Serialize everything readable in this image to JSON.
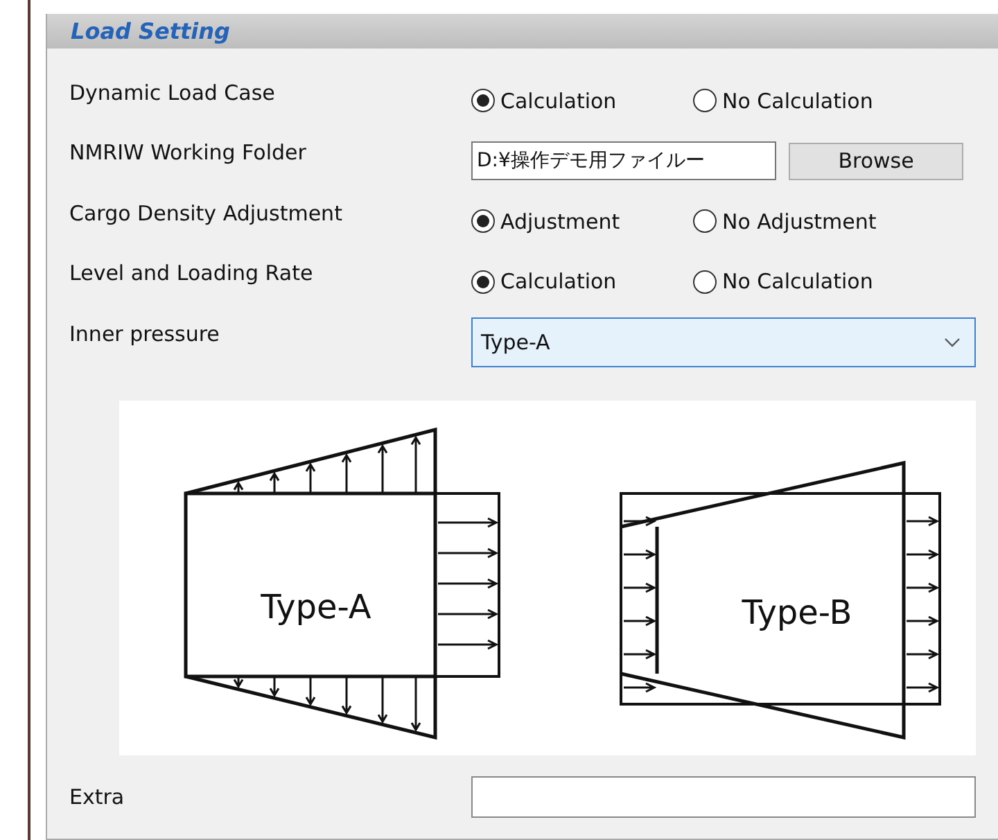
{
  "panel": {
    "title": "Load Setting"
  },
  "rows": [
    {
      "kind": "radio",
      "label": "Dynamic Load Case",
      "options": [
        {
          "label": "Calculation",
          "selected": true
        },
        {
          "label": "No Calculation",
          "selected": false
        }
      ]
    },
    {
      "kind": "folder",
      "label": "NMRIW Working Folder",
      "value": "D:¥操作デモ用ファイルー",
      "button": "Browse"
    },
    {
      "kind": "radio",
      "label": "Cargo Density Adjustment",
      "options": [
        {
          "label": "Adjustment",
          "selected": true
        },
        {
          "label": "No Adjustment",
          "selected": false
        }
      ]
    },
    {
      "kind": "radio",
      "label": "Level and Loading Rate",
      "options": [
        {
          "label": "Calculation",
          "selected": true
        },
        {
          "label": "No Calculation",
          "selected": false
        }
      ]
    },
    {
      "kind": "select",
      "label": "Inner pressure",
      "value": "Type-A"
    }
  ],
  "diagram": {
    "labels": [
      "Type-A",
      "Type-B"
    ]
  },
  "extra": {
    "label": "Extra"
  }
}
